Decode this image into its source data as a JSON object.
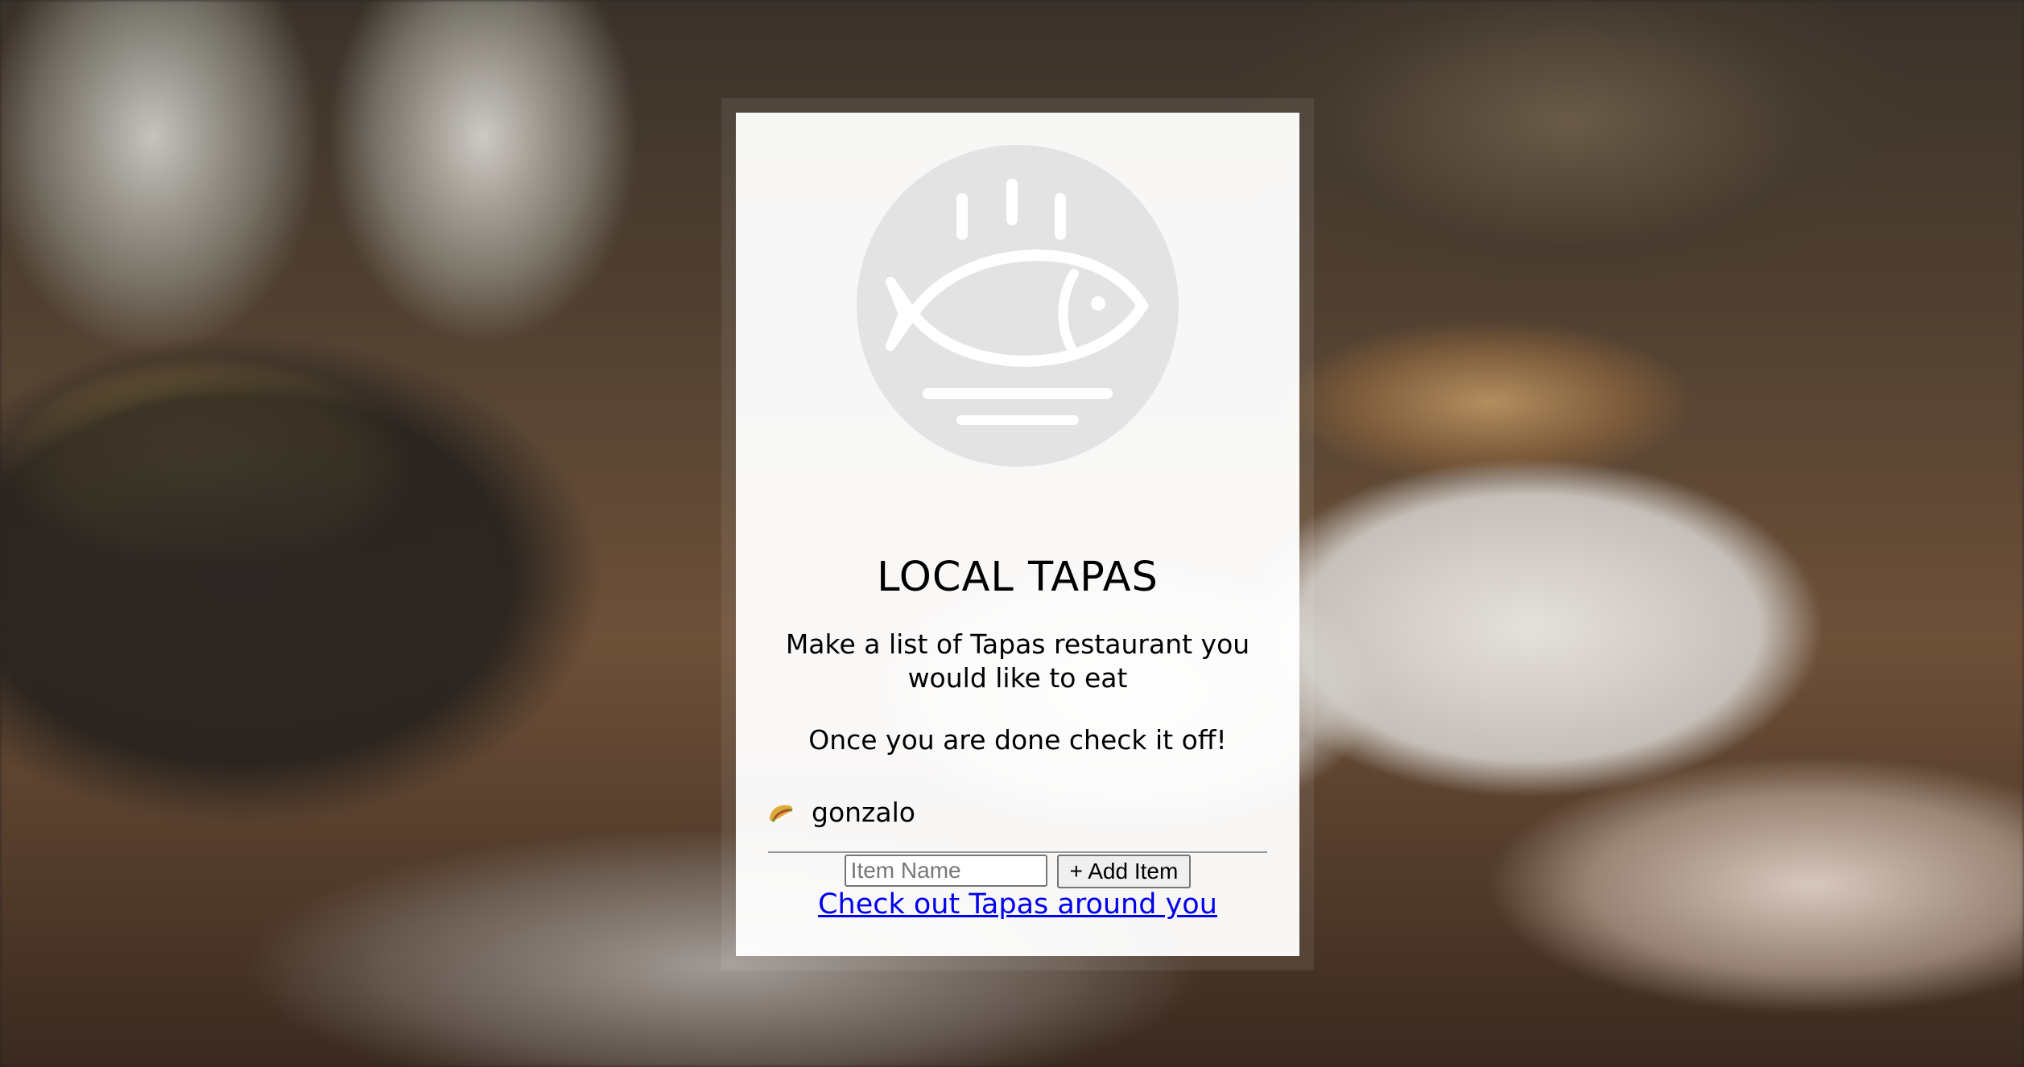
{
  "header": {
    "title": "LOCAL TAPAS",
    "subtitle": "Make a list of Tapas restaurant you would like to eat",
    "note": "Once you are done check it off!"
  },
  "logo": {
    "icon": "fish-plate-icon"
  },
  "list": {
    "items": [
      {
        "icon": "taco-icon",
        "name": "gonzalo"
      }
    ]
  },
  "add_form": {
    "placeholder": "Item Name",
    "button_label": "+ Add Item"
  },
  "footer": {
    "link_text": "Check out Tapas around you"
  },
  "colors": {
    "link": "#0000ee",
    "logo_circle": "#e3e3e3",
    "panel": "#ffffff"
  }
}
